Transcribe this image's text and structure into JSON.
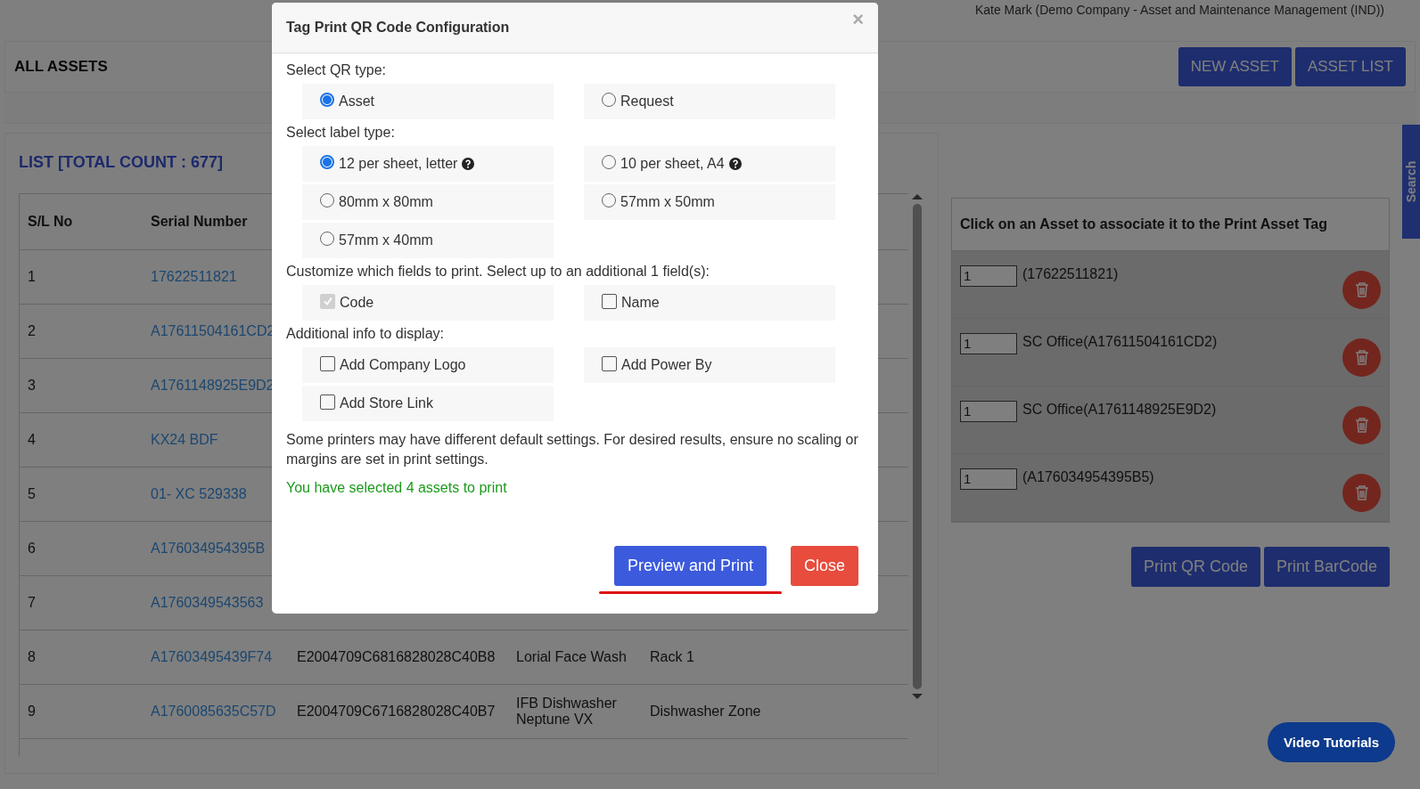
{
  "header": {
    "user": "Kate Mark (Demo Company - Asset and Maintenance Management (IND))"
  },
  "page": {
    "title": "ALL ASSETS",
    "buttons": [
      "NEW ASSET",
      "ASSET LIST"
    ]
  },
  "list": {
    "title": "LIST [TOTAL COUNT : 677]",
    "columns": [
      "S/L No",
      "Serial Number"
    ],
    "rows": [
      {
        "sl": "1",
        "serial": "17622511821"
      },
      {
        "sl": "2",
        "serial": "A17611504161CD2"
      },
      {
        "sl": "3",
        "serial": "A1761148925E9D2"
      },
      {
        "sl": "4",
        "serial": "KX24 BDF"
      },
      {
        "sl": "5",
        "serial": "01- XC 529338"
      },
      {
        "sl": "6",
        "serial": "A176034954395B"
      },
      {
        "sl": "7",
        "serial": "A1760349543563"
      },
      {
        "sl": "8",
        "serial": "A17603495439F74",
        "column_3": "E2004709C6816828028C40B8",
        "column_4": "Lorial Face Wash",
        "column_5": "Rack 1"
      },
      {
        "sl": "9",
        "serial": "A1760085635C57D",
        "column_3": "E2004709C6716828028C40B7",
        "column_4": "IFB Dishwasher Neptune VX",
        "column_5": "Dishwasher Zone"
      }
    ]
  },
  "print_panel": {
    "title": "Click on an Asset to associate it to the Print Asset Tag",
    "items": [
      {
        "quantity": "1",
        "label": "(17622511821)"
      },
      {
        "quantity": "1",
        "label": "SC Office(A17611504161CD2)"
      },
      {
        "quantity": "1",
        "label": "SC Office(A1761148925E9D2)"
      },
      {
        "quantity": "1",
        "label": "(A176034954395B5)"
      }
    ],
    "buttons": [
      "Print QR Code",
      "Print BarCode"
    ]
  },
  "side_tab": "Search",
  "video_button": "Video Tutorials",
  "dialog": {
    "title": "Tag Print QR Code Configuration",
    "close": "×",
    "sections": [
      {
        "label": "Select QR type:",
        "kind": "radio",
        "options": [
          {
            "label": "Asset",
            "selected": true
          },
          {
            "label": "Request",
            "selected": false
          }
        ]
      },
      {
        "label": "Select label type:",
        "kind": "radio",
        "options": [
          {
            "label": "12 per sheet, letter",
            "selected": true,
            "help": true
          },
          {
            "label": "10 per sheet, A4",
            "selected": false,
            "help": true
          },
          {
            "label": "80mm x 80mm",
            "selected": false
          },
          {
            "label": "57mm x 50mm",
            "selected": false
          },
          {
            "label": "57mm x 40mm",
            "selected": false
          }
        ]
      },
      {
        "label": "Customize which fields to print. Select up to an additional 1 field(s):",
        "kind": "checkbox",
        "options": [
          {
            "label": "Code",
            "checked": true,
            "disabled": true
          },
          {
            "label": "Name",
            "checked": false,
            "disabled": false
          }
        ]
      },
      {
        "label": "Additional info to display:",
        "kind": "checkbox",
        "options": [
          {
            "label": "Add Company Logo",
            "checked": false,
            "disabled": false
          },
          {
            "label": "Add Power By",
            "checked": false,
            "disabled": false
          },
          {
            "label": "Add Store Link",
            "checked": false,
            "disabled": false
          }
        ]
      }
    ],
    "note": "Some printers may have different default settings. For desired results, ensure no scaling or margins are set in print settings.",
    "status": "You have selected 4 assets to print",
    "buttons": [
      {
        "label": "Preview and Print",
        "kind": "primary",
        "underlined": true
      },
      {
        "label": "Close",
        "kind": "danger",
        "underlined": false
      }
    ]
  }
}
